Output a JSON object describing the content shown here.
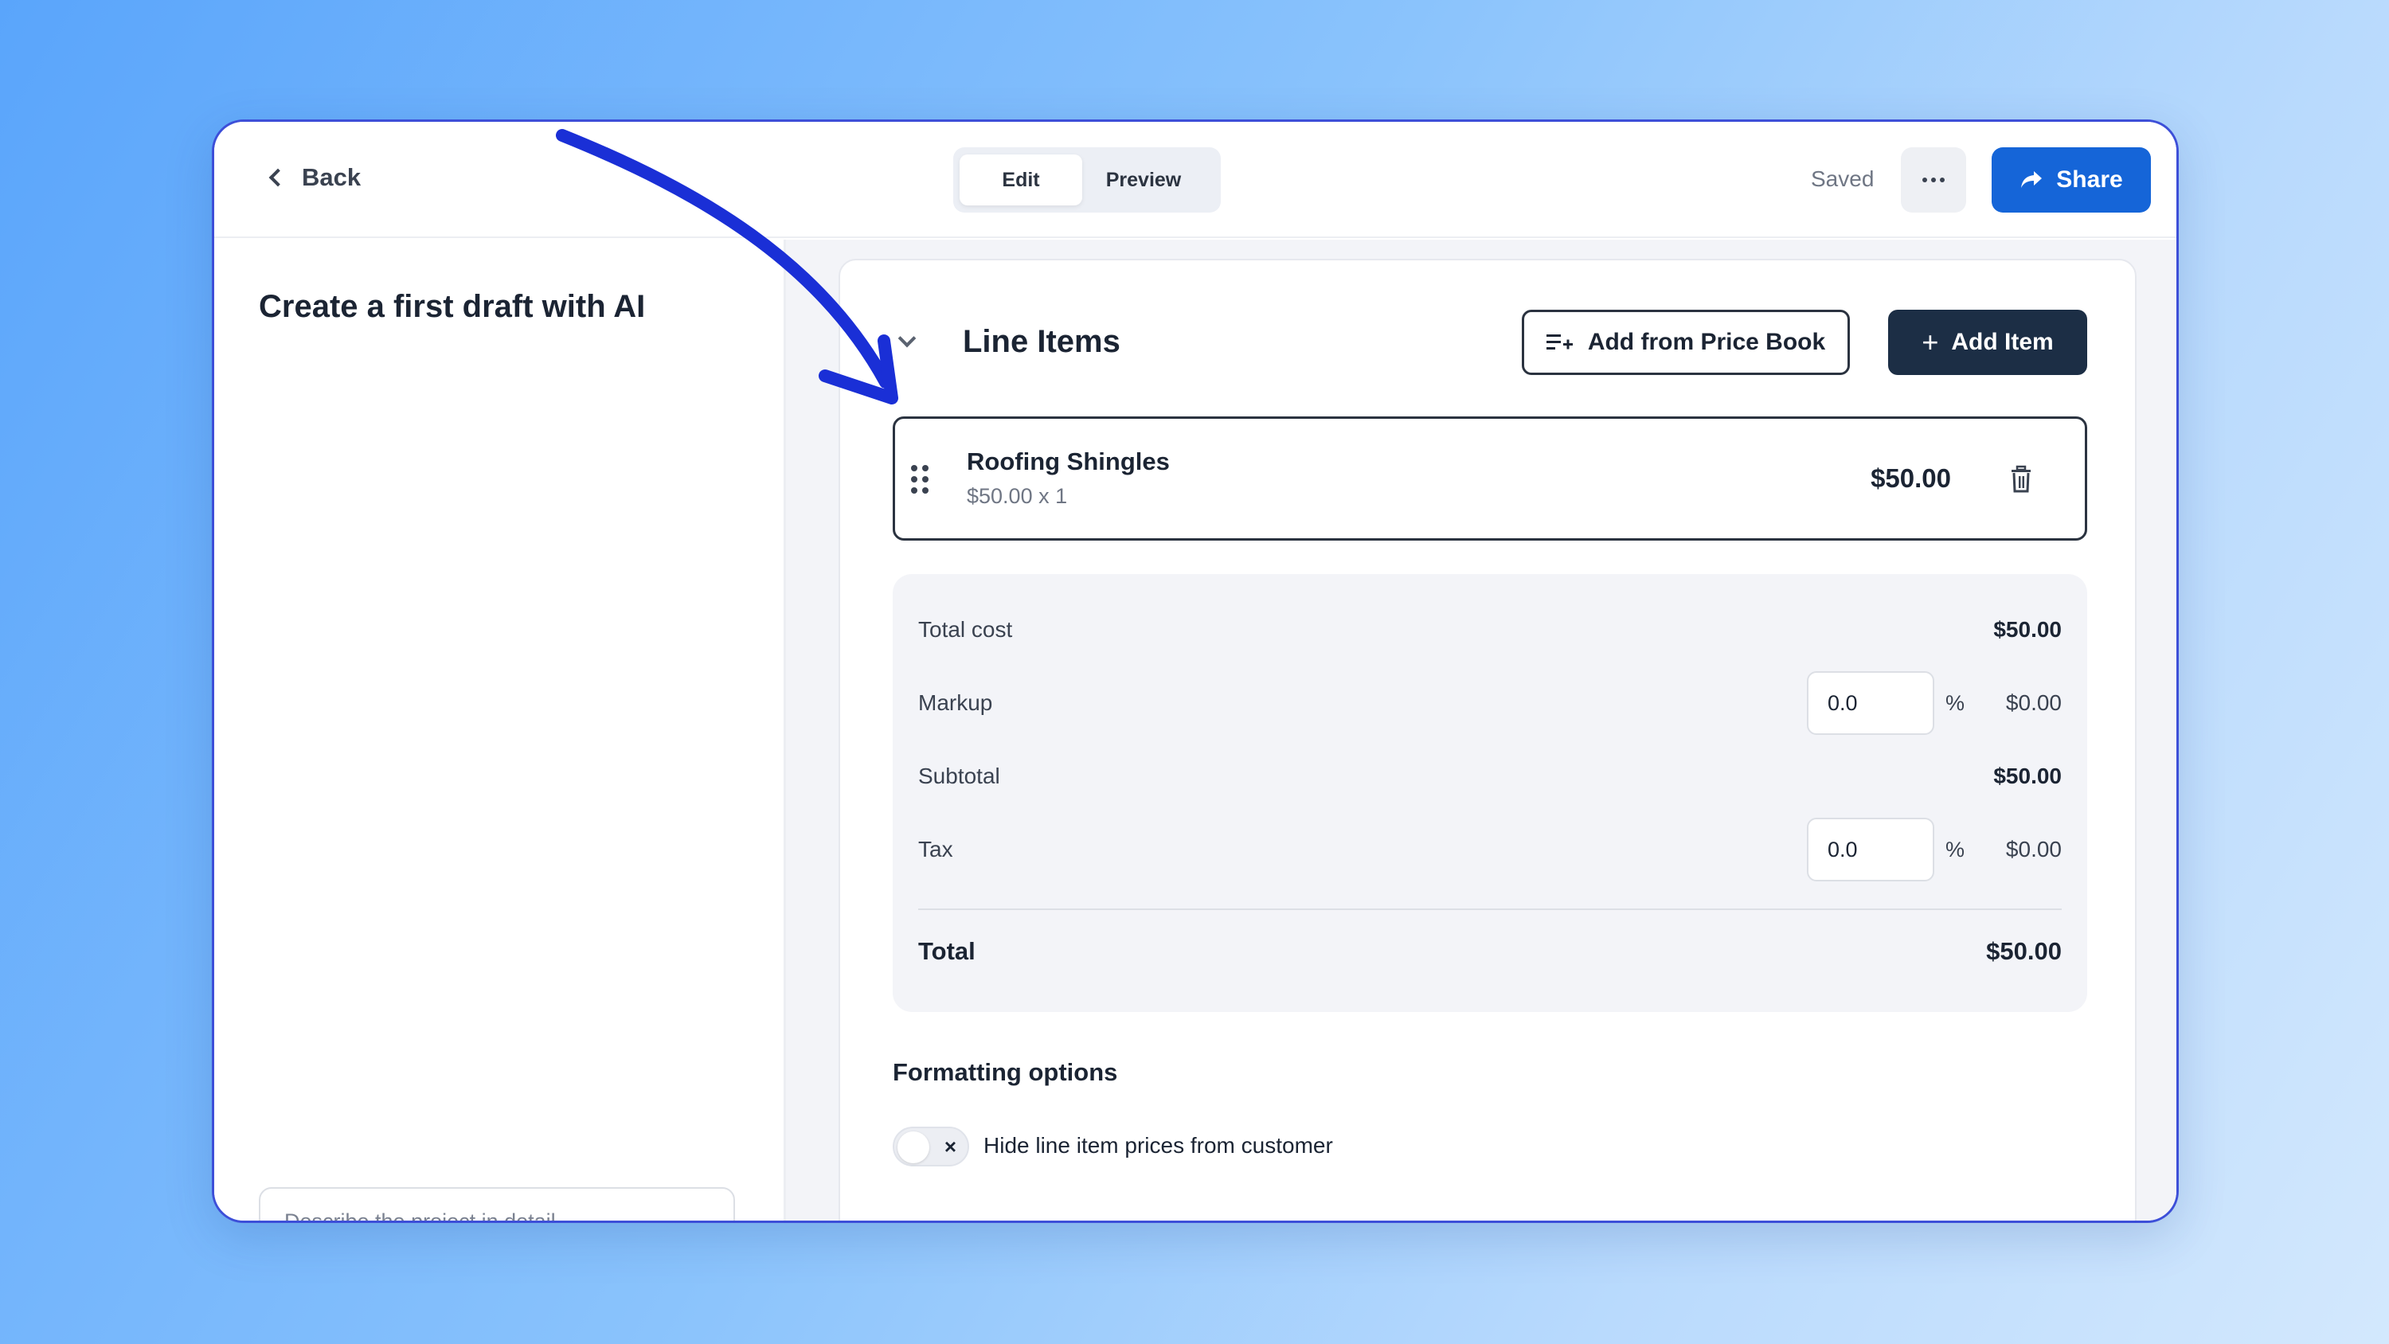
{
  "topbar": {
    "back_label": "Back",
    "tabs": [
      {
        "label": "Edit",
        "active": true
      },
      {
        "label": "Preview",
        "active": false
      }
    ],
    "status": "Saved",
    "share_label": "Share"
  },
  "sidebar": {
    "title": "Create a first draft with AI",
    "prompt_placeholder": "Describe the project in detail..."
  },
  "section": {
    "title": "Line Items",
    "add_from_price_book_label": "Add from Price Book",
    "add_item_label": "Add Item"
  },
  "line_items": [
    {
      "name": "Roofing Shingles",
      "detail": "$50.00 x 1",
      "price": "$50.00"
    }
  ],
  "summary": {
    "total_cost_label": "Total cost",
    "total_cost_value": "$50.00",
    "markup_label": "Markup",
    "markup_input": "0.0",
    "markup_unit": "%",
    "markup_value": "$0.00",
    "subtotal_label": "Subtotal",
    "subtotal_value": "$50.00",
    "tax_label": "Tax",
    "tax_input": "0.0",
    "tax_unit": "%",
    "tax_value": "$0.00",
    "total_label": "Total",
    "total_value": "$50.00"
  },
  "formatting": {
    "title": "Formatting options",
    "hide_prices_label": "Hide line item prices from customer",
    "hide_prices_enabled": false
  },
  "colors": {
    "primary": "#1565d8",
    "dark_button": "#1c2e45",
    "annotation_arrow": "#1a2fd6",
    "window_border": "#3d4fd8"
  }
}
